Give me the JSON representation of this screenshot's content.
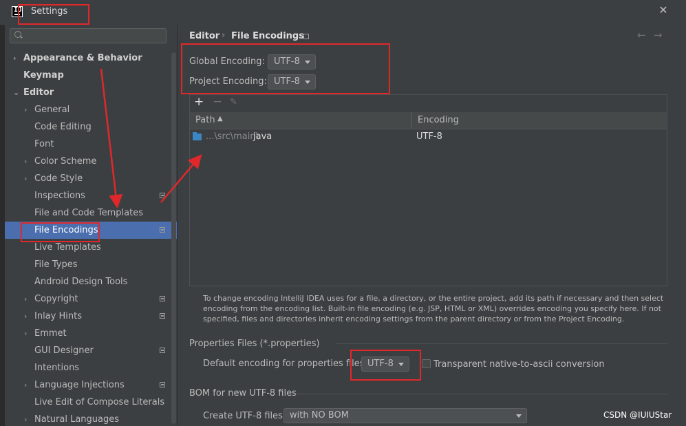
{
  "window": {
    "title": "Settings",
    "close_glyph": "✕"
  },
  "sidebar": {
    "search_placeholder": "",
    "items": [
      {
        "label": "Appearance & Behavior",
        "chevron": "›",
        "bold": true
      },
      {
        "label": "Keymap",
        "bold": true
      },
      {
        "label": "Editor",
        "chevron": "⌄",
        "bold": true
      },
      {
        "label": "General",
        "chevron": "›"
      },
      {
        "label": "Code Editing"
      },
      {
        "label": "Font"
      },
      {
        "label": "Color Scheme",
        "chevron": "›"
      },
      {
        "label": "Code Style",
        "chevron": "›"
      },
      {
        "label": "Inspections",
        "icon": "settings-scope-icon"
      },
      {
        "label": "File and Code Templates"
      },
      {
        "label": "File Encodings",
        "icon": "settings-scope-icon",
        "selected": true
      },
      {
        "label": "Live Templates"
      },
      {
        "label": "File Types"
      },
      {
        "label": "Android Design Tools"
      },
      {
        "label": "Copyright",
        "chevron": "›",
        "icon": "settings-scope-icon"
      },
      {
        "label": "Inlay Hints",
        "chevron": "›",
        "icon": "settings-scope-icon"
      },
      {
        "label": "Emmet",
        "chevron": "›"
      },
      {
        "label": "GUI Designer",
        "icon": "settings-scope-icon"
      },
      {
        "label": "Intentions"
      },
      {
        "label": "Language Injections",
        "chevron": "›",
        "icon": "settings-scope-icon"
      },
      {
        "label": "Live Edit of Compose Literals"
      },
      {
        "label": "Natural Languages",
        "chevron": "›"
      }
    ]
  },
  "breadcrumb": {
    "parent": "Editor",
    "separator": "›",
    "current": "File Encodings"
  },
  "nav": {
    "back": "←",
    "forward": "→"
  },
  "global_encoding": {
    "label": "Global Encoding:",
    "value": "UTF-8"
  },
  "project_encoding": {
    "label": "Project Encoding:",
    "value": "UTF-8"
  },
  "table": {
    "toolbar": {
      "add": "+",
      "remove": "−",
      "edit": "✎"
    },
    "columns": [
      "Path",
      "Encoding"
    ],
    "sort_indicator": "▲",
    "rows": [
      {
        "path_prefix": "...\\src\\main\\",
        "path_name": "java",
        "encoding": "UTF-8"
      }
    ]
  },
  "help_text": "To change encoding IntelliJ IDEA uses for a file, a directory, or the entire project, add its path if necessary and then select encoding from the encoding list. Built-in file encoding (e.g. JSP, HTML or XML) overrides encoding you specify here. If not specified, files and directories inherit encoding settings from the parent directory or from the Project Encoding.",
  "properties": {
    "section_title": "Properties Files (*.properties)",
    "default_label": "Default encoding for properties files",
    "default_value": "UTF-8",
    "transparent_label": "Transparent native-to-ascii conversion",
    "transparent_checked": false
  },
  "bom": {
    "section_title": "BOM for new UTF-8 files",
    "create_label": "Create UTF-8 files:",
    "create_value": "with NO BOM"
  },
  "watermark": "CSDN @IUIUStar",
  "colors": {
    "selection": "#4b6eaf",
    "annotation": "#e0282b",
    "folder": "#3b87c4"
  }
}
